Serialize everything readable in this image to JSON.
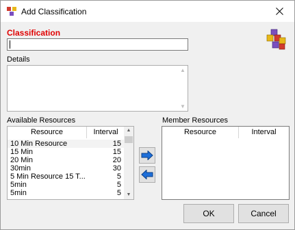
{
  "window": {
    "title": "Add Classification",
    "close_glyph": "✕"
  },
  "form": {
    "classification_label": "Classification",
    "classification_value": "",
    "details_label": "Details",
    "details_value": ""
  },
  "available": {
    "label": "Available Resources",
    "columns": [
      "Resource",
      "Interval"
    ],
    "rows": [
      {
        "resource": "10 Min Resource",
        "interval": "15"
      },
      {
        "resource": "15 Min",
        "interval": "15"
      },
      {
        "resource": "20 Min",
        "interval": "20"
      },
      {
        "resource": "30min",
        "interval": "30"
      },
      {
        "resource": "5 Min Resource 15 T...",
        "interval": "5"
      },
      {
        "resource": "5min",
        "interval": "5"
      },
      {
        "resource": "5min",
        "interval": "5"
      }
    ]
  },
  "member": {
    "label": "Member Resources",
    "columns": [
      "Resource",
      "Interval"
    ],
    "rows": []
  },
  "buttons": {
    "ok": "OK",
    "cancel": "Cancel"
  },
  "colors": {
    "required_label": "#e00000",
    "arrow_blue": "#1e6fd9"
  }
}
